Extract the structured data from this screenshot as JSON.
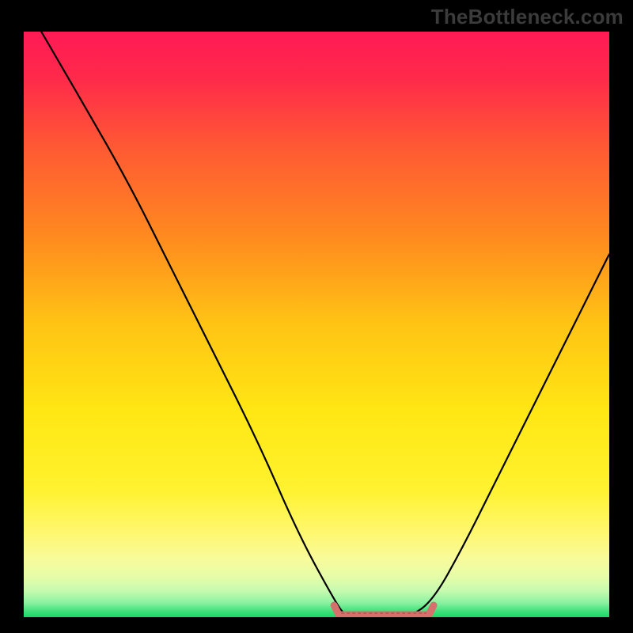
{
  "watermark": "TheBottleneck.com",
  "colors": {
    "frame": "#000000",
    "watermark_text": "#3b3b3b",
    "curve": "#000000",
    "bottom_marker": "#d6706c",
    "gradient_stops": [
      {
        "offset": 0.0,
        "color": "#ff1a55"
      },
      {
        "offset": 0.08,
        "color": "#ff2a4a"
      },
      {
        "offset": 0.2,
        "color": "#ff5a33"
      },
      {
        "offset": 0.35,
        "color": "#ff8a1f"
      },
      {
        "offset": 0.5,
        "color": "#ffc414"
      },
      {
        "offset": 0.65,
        "color": "#ffe714"
      },
      {
        "offset": 0.78,
        "color": "#fff22e"
      },
      {
        "offset": 0.85,
        "color": "#fff76a"
      },
      {
        "offset": 0.9,
        "color": "#f8fb9a"
      },
      {
        "offset": 0.93,
        "color": "#e6fca8"
      },
      {
        "offset": 0.955,
        "color": "#c6fbaf"
      },
      {
        "offset": 0.975,
        "color": "#8cf2a0"
      },
      {
        "offset": 0.99,
        "color": "#3fe07c"
      },
      {
        "offset": 1.0,
        "color": "#19d867"
      }
    ]
  },
  "chart_data": {
    "type": "line",
    "title": "",
    "xlabel": "",
    "ylabel": "",
    "xlim": [
      0,
      100
    ],
    "ylim": [
      0,
      100
    ],
    "grid": false,
    "legend": false,
    "series": [
      {
        "name": "bottleneck-curve",
        "x": [
          3,
          10,
          18,
          25,
          32,
          40,
          47,
          53,
          55,
          58,
          62,
          66,
          70,
          75,
          80,
          86,
          92,
          98,
          100
        ],
        "values": [
          100,
          88,
          74,
          60,
          46,
          30,
          14,
          3,
          0,
          0,
          0,
          0,
          3,
          12,
          22,
          34,
          46,
          58,
          62
        ]
      }
    ],
    "optimal_range_x": [
      53,
      70
    ],
    "annotations": []
  }
}
